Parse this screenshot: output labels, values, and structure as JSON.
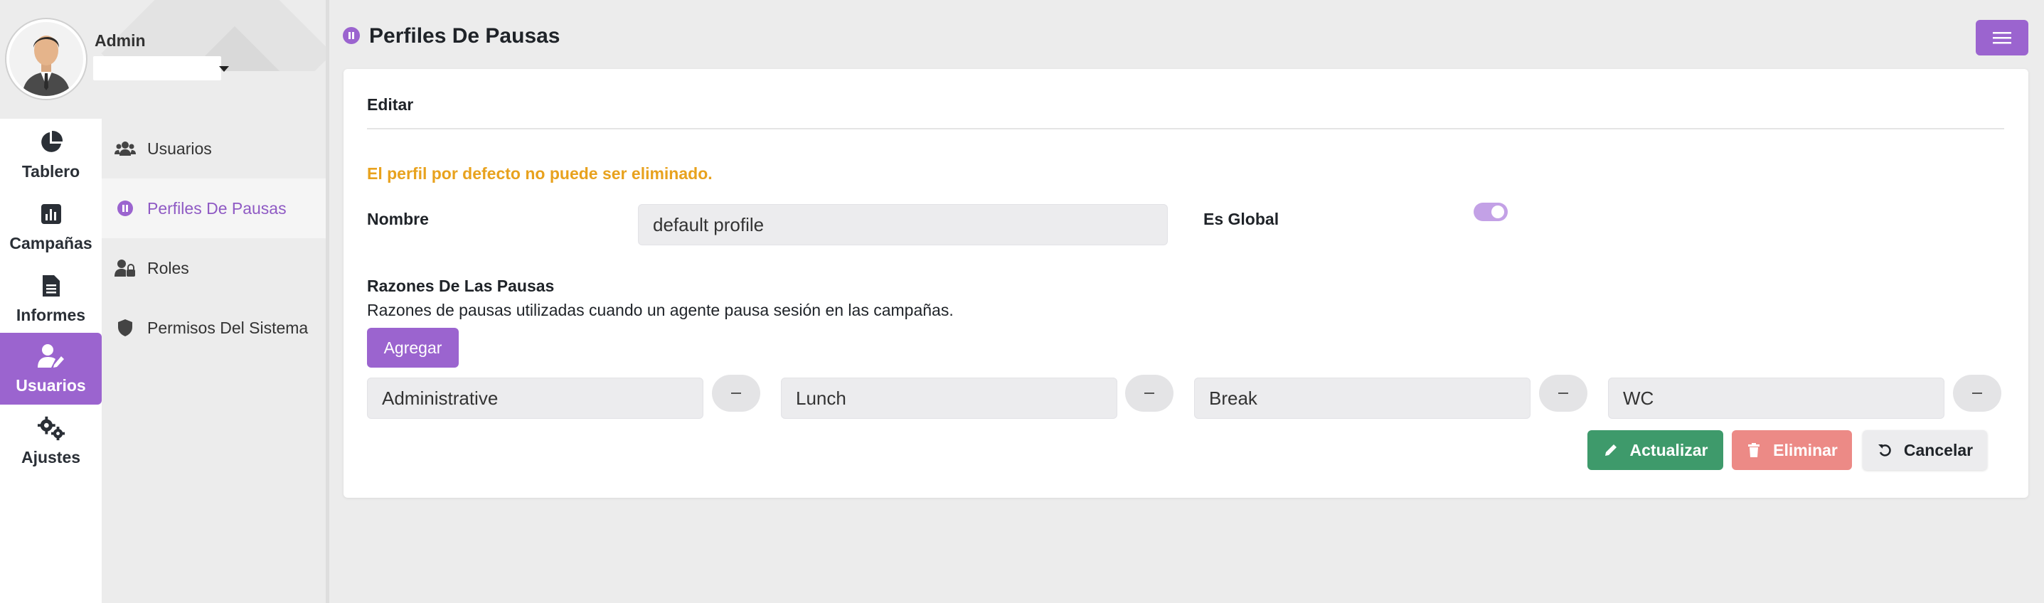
{
  "user": {
    "name": "Admin",
    "selector_value": ""
  },
  "rail": {
    "items": [
      {
        "label": "Tablero",
        "icon": "pie-chart-icon"
      },
      {
        "label": "Campañas",
        "icon": "bar-chart-icon"
      },
      {
        "label": "Informes",
        "icon": "document-icon"
      },
      {
        "label": "Usuarios",
        "icon": "user-edit-icon",
        "active": true
      },
      {
        "label": "Ajustes",
        "icon": "gears-icon"
      }
    ]
  },
  "submenu": {
    "items": [
      {
        "label": "Usuarios",
        "icon": "users-icon"
      },
      {
        "label": "Perfiles De Pausas",
        "icon": "pause-circle-icon",
        "active": true
      },
      {
        "label": "Roles",
        "icon": "user-lock-icon"
      },
      {
        "label": "Permisos Del Sistema",
        "icon": "shield-icon"
      }
    ]
  },
  "header": {
    "title": "Perfiles De Pausas"
  },
  "form": {
    "section_title": "Editar",
    "warning": "El perfil por defecto no puede ser eliminado.",
    "name_label": "Nombre",
    "name_value": "default profile",
    "global_label": "Es Global",
    "global_on": true,
    "reasons_title": "Razones De Las Pausas",
    "reasons_desc": "Razones de pausas utilizadas cuando un agente pausa sesión en las campañas.",
    "add_label": "Agregar",
    "reasons": [
      "Administrative",
      "Lunch",
      "Break",
      "WC"
    ]
  },
  "actions": {
    "update": "Actualizar",
    "delete": "Eliminar",
    "cancel": "Cancelar"
  },
  "colors": {
    "accent": "#9b64cf",
    "warning": "#e8a21e",
    "success": "#3e9a6b",
    "danger": "#ec8a86"
  }
}
